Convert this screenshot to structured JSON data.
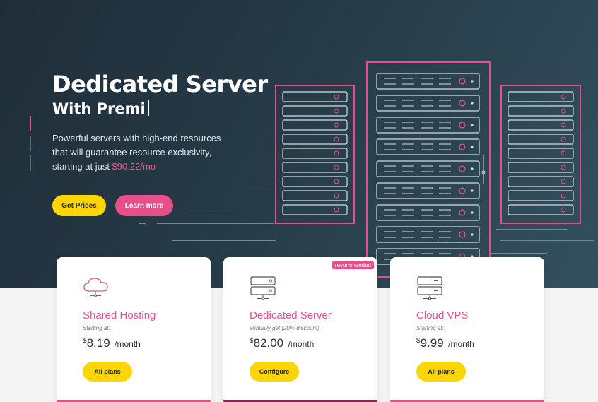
{
  "hero": {
    "title": "Dedicated Server",
    "subtitle": "With Premi",
    "desc_line1": "Powerful servers with high-end resources",
    "desc_line2": "that will guarantee resource exclusivity,",
    "desc_line3_prefix": "starting at just ",
    "desc_price": "$90.22/mo",
    "btn_prices": "Get Prices",
    "btn_learn": "Learn more"
  },
  "cards": [
    {
      "title": "Shared Hosting",
      "meta": "Starting at:",
      "currency": "$",
      "amount": "8.19",
      "period": "/month",
      "button": "All plans",
      "icon": "cloud-icon"
    },
    {
      "title": "Dedicated Server",
      "meta": "annually get (20% discount)",
      "currency": "$",
      "amount": "82.00",
      "period": "/month",
      "button": "Configure",
      "badge": "recommended",
      "icon": "server-icon"
    },
    {
      "title": "Cloud VPS",
      "meta": "Starting at:",
      "currency": "$",
      "amount": "9.99",
      "period": "/month",
      "button": "All plans",
      "icon": "vps-icon"
    }
  ],
  "colors": {
    "accent_pink": "#e5508a",
    "accent_yellow": "#fcd506",
    "hero_bg": "#263a47",
    "rack_line": "#d8dde2"
  }
}
